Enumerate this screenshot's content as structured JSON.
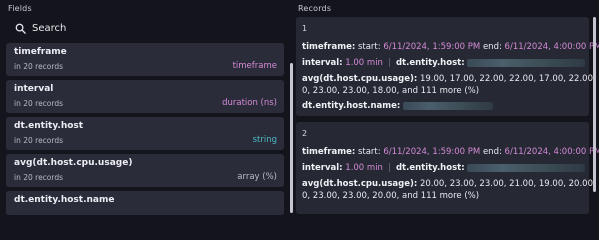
{
  "panes": {
    "fields_label": "Fields",
    "records_label": "Records"
  },
  "search": {
    "placeholder": "Search",
    "icon": "search-icon"
  },
  "colors": {
    "accent_magenta": "#d58ad8",
    "accent_teal": "#4fb8c7",
    "card_bg": "#2a2d39",
    "page_bg": "#14151c"
  },
  "fields": [
    {
      "name": "timeframe",
      "count": "in 20 records",
      "type": "timeframe"
    },
    {
      "name": "interval",
      "count": "in 20 records",
      "type": "duration (ns)"
    },
    {
      "name": "dt.entity.host",
      "count": "in 20 records",
      "type": "string"
    },
    {
      "name": "avg(dt.host.cpu.usage)",
      "count": "in 20 records",
      "type": "array (%)"
    },
    {
      "name": "dt.entity.host.name",
      "count": "",
      "type": ""
    }
  ],
  "records": [
    {
      "index": "1",
      "timeframe_key": "timeframe:",
      "start_label": "start:",
      "start_value": "6/11/2024, 1:59:00 PM",
      "end_label": "end:",
      "end_value": "6/11/2024, 4:00:00 PM",
      "interval_key": "interval:",
      "interval_value": "1.00 min",
      "host_key": "dt.entity.host:",
      "avg_key": "avg(dt.host.cpu.usage):",
      "avg_line1": "19.00, 17.00, 22.00, 22.00, 17.00, 22.00, 23.0",
      "avg_line2": "0, 23.00, 23.00, 18.00, and 111 more (%)",
      "hostname_key": "dt.entity.host.name:"
    },
    {
      "index": "2",
      "timeframe_key": "timeframe:",
      "start_label": "start:",
      "start_value": "6/11/2024, 1:59:00 PM",
      "end_label": "end:",
      "end_value": "6/11/2024, 4:00:00 PM",
      "interval_key": "interval:",
      "interval_value": "1.00 min",
      "host_key": "dt.entity.host:",
      "avg_key": "avg(dt.host.cpu.usage):",
      "avg_line1": "20.00, 23.00, 23.00, 21.00, 19.00, 20.00, 22.0",
      "avg_line2": "0, 23.00, 23.00, 20.00, and 111 more (%)"
    }
  ]
}
